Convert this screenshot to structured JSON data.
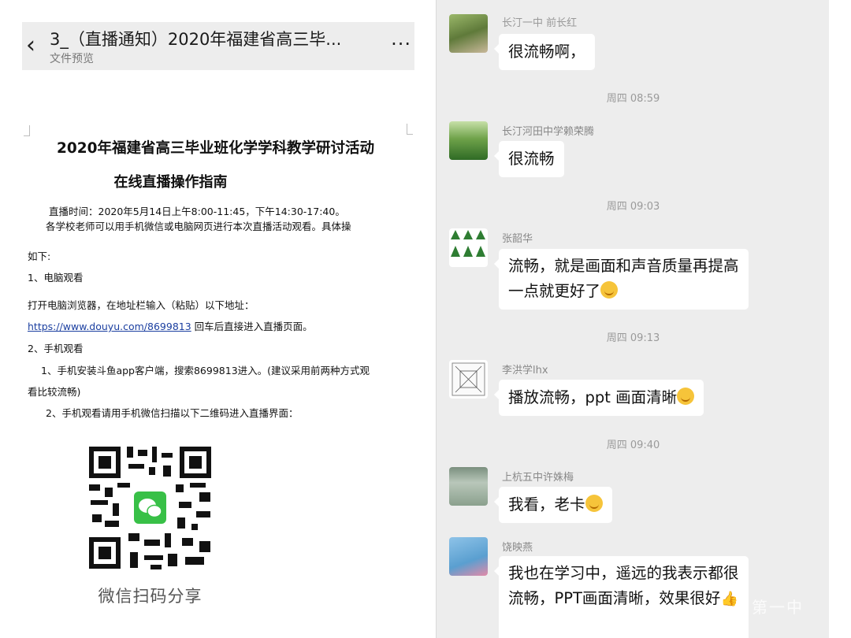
{
  "document": {
    "header": {
      "title": "3_（直播通知）2020年福建省高三毕...",
      "subtitle": "文件预览",
      "back_icon": "chevron-left-icon",
      "more_icon": "ellipsis-icon"
    },
    "heading": "2020年福建省高三毕业班化学学科教学研讨活动",
    "subheading": "在线直播操作指南",
    "lines": {
      "time": "直播时间：2020年5月14日上午8:00-11:45，下午14:30-17:40。",
      "intro": "各学校老师可以用手机微信或电脑网页进行本次直播活动观看。具体操",
      "as_follows": "如下:",
      "pc_title": "1、电脑观看",
      "pc_step": "打开电脑浏览器，在地址栏输入（粘贴）以下地址：",
      "url": "https://www.douyu.com/8699813",
      "url_after": " 回车后直接进入直播页面。",
      "mobile_title": "2、手机观看",
      "mobile_step1a": "1、手机安装斗鱼app客户端，搜索8699813进入。(建议采用前两种方式观",
      "mobile_step1b": "看比较流畅)",
      "mobile_step2": "2、手机观看请用手机微信扫描以下二维码进入直播界面："
    },
    "qr_caption": "微信扫码分享"
  },
  "chat": {
    "top_sender": "长汀一中 前长红",
    "messages": [
      {
        "timestamp": "",
        "sender": "",
        "text": "很流畅啊，"
      },
      {
        "timestamp": "周四 08:59",
        "sender": "长汀河田中学赖荣腾",
        "text": "很流畅"
      },
      {
        "timestamp": "周四 09:03",
        "sender": "张韶华",
        "text_l1": "流畅，就是画面和声音质量再提高",
        "text_l2": "一点就更好了"
      },
      {
        "timestamp": "周四 09:13",
        "sender": "李洪学lhx",
        "text": "播放流畅，ppt 画面清晰"
      },
      {
        "timestamp": "周四 09:40",
        "sender": "上杭五中许姝梅",
        "text": "我看，老卡"
      },
      {
        "timestamp": "",
        "sender": "饶映燕",
        "text_l1": "我也在学习中，遥远的我表示都很",
        "text_l2": "流畅，PPT画面清晰，效果很好"
      }
    ],
    "watermark": "第一中"
  },
  "colors": {
    "chat_bg": "#ededed",
    "bubble": "#ffffff",
    "link": "#1b3fa0",
    "timestamp": "#9a9a9a"
  }
}
